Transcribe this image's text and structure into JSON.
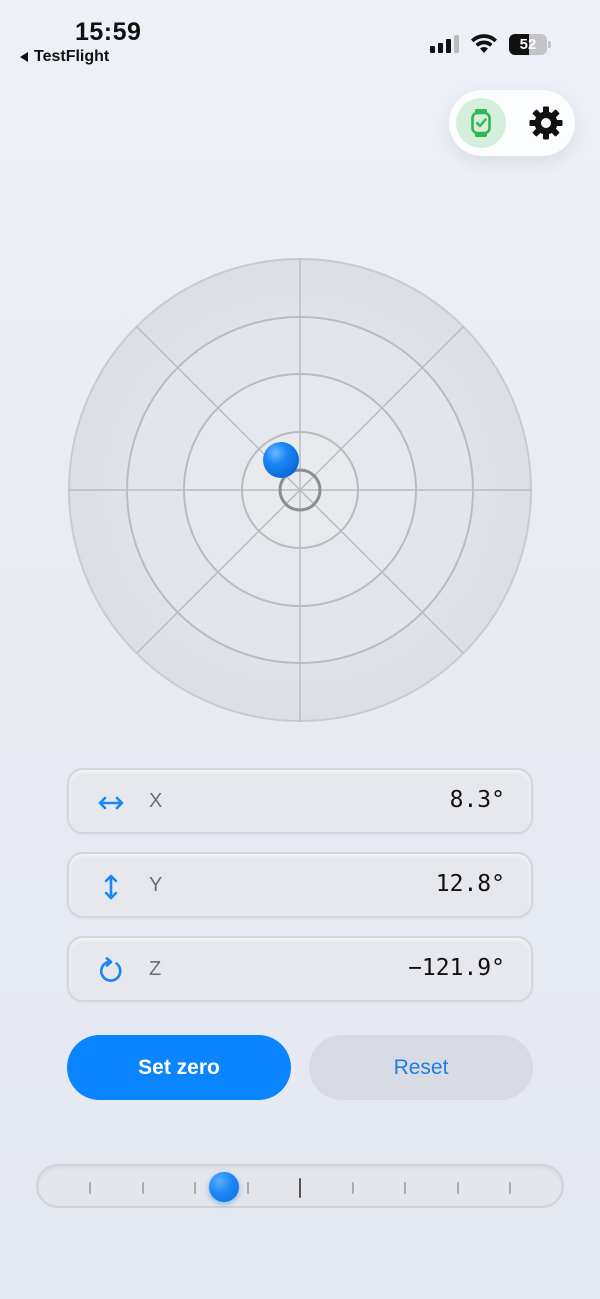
{
  "status_bar": {
    "time": "15:59",
    "back_app": "TestFlight",
    "battery": "52"
  },
  "toolbar": {
    "watch_icon": "watch-icon",
    "settings_icon": "gear-icon",
    "watch_bg": "#d4f0dc",
    "watch_color": "#2fb84f"
  },
  "radar": {
    "rings": 4,
    "bubble_offset_deg": {
      "x": 8.3,
      "y": 12.8
    }
  },
  "readings": [
    {
      "icon": "horizontal-arrows-icon",
      "axis": "X",
      "value": "8.3°"
    },
    {
      "icon": "vertical-arrows-icon",
      "axis": "Y",
      "value": "12.8°"
    },
    {
      "icon": "rotate-icon",
      "axis": "Z",
      "value": "−121.9°"
    }
  ],
  "buttons": {
    "set_zero": "Set zero",
    "reset": "Reset"
  },
  "slider": {
    "tick_count": 9,
    "center_index": 4,
    "position_fraction": 0.32
  },
  "colors": {
    "accent": "#0a84ff",
    "secondary_button": "#d8dbe3",
    "secondary_text": "#1f7fe0"
  }
}
